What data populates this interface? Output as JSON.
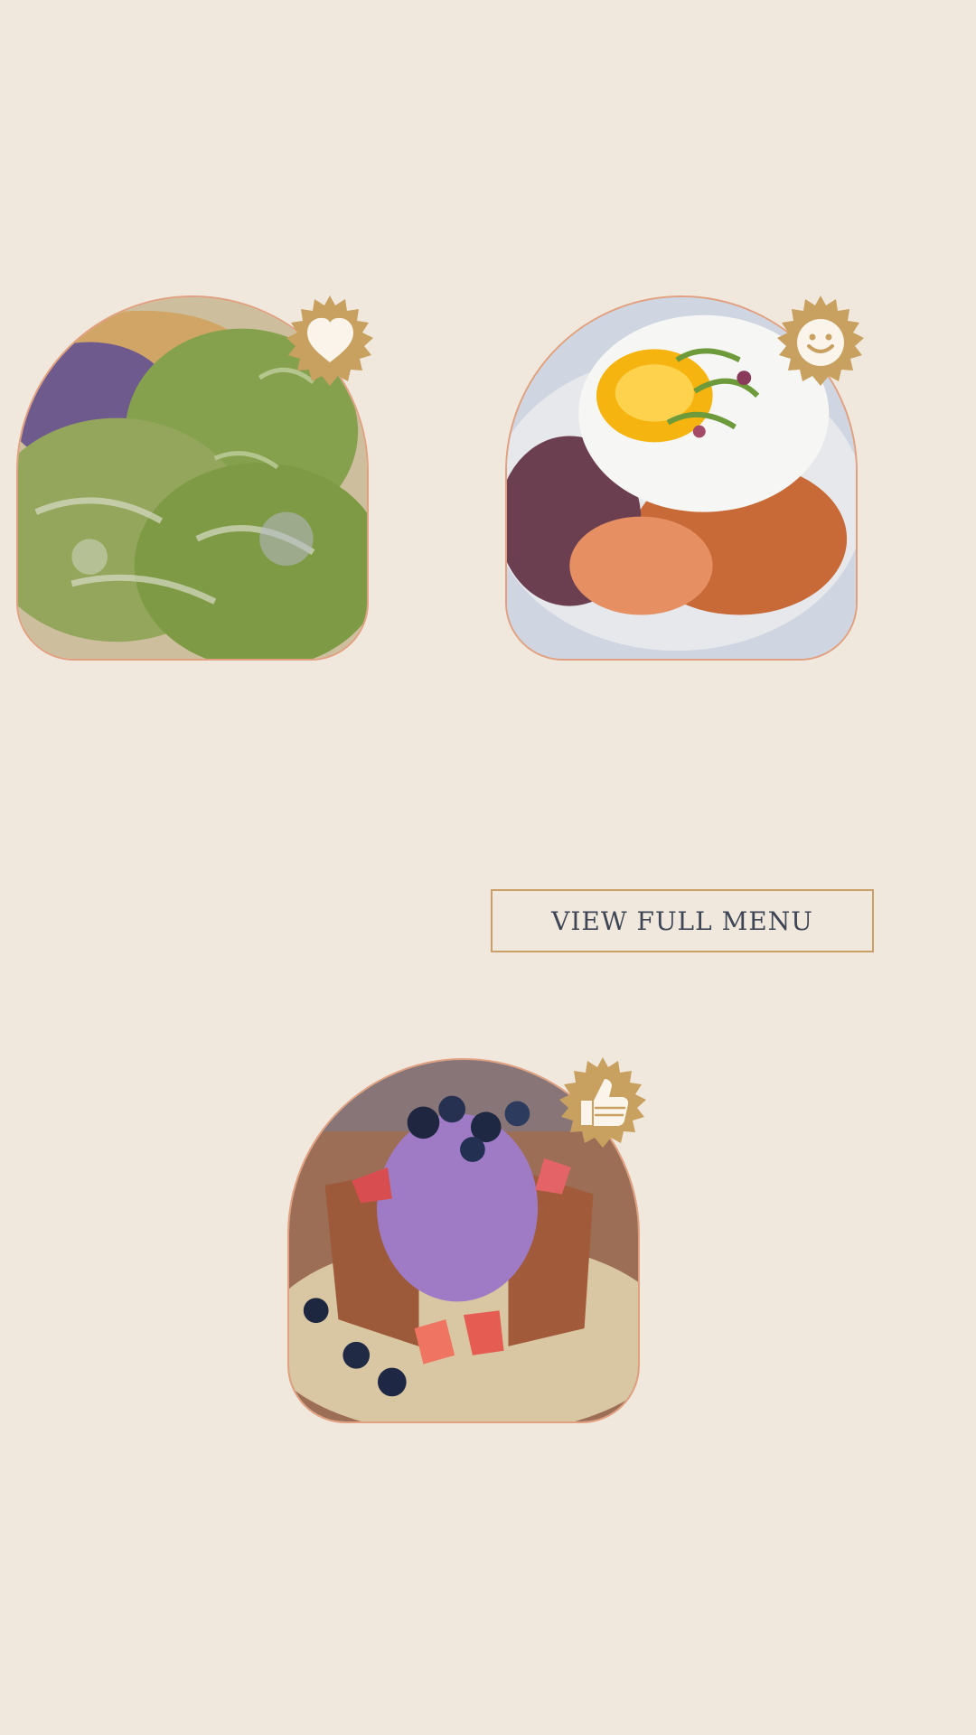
{
  "menu_button": {
    "label": "VIEW FULL MENU"
  },
  "cards": [
    {
      "name": "ube-matcha-bread-card",
      "badge_icon": "heart-icon"
    },
    {
      "name": "egg-rice-bowl-card",
      "badge_icon": "smiley-face-icon"
    },
    {
      "name": "ube-toast-dessert-card",
      "badge_icon": "thumbs-up-icon"
    }
  ],
  "colors": {
    "background": "#f0e8dd",
    "photo_border": "#e1a07f",
    "badge": "#c8a060",
    "badge_icon": "#fbf4ea",
    "button_border": "#c9a06a",
    "button_text": "#3e4656"
  }
}
